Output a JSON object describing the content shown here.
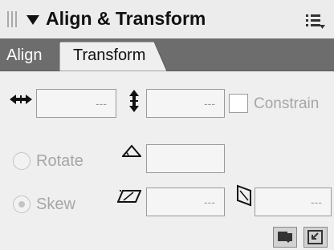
{
  "panel": {
    "title": "Align & Transform",
    "tabs": [
      {
        "label": "Align",
        "active": false
      },
      {
        "label": "Transform",
        "active": true
      }
    ]
  },
  "transform": {
    "width_value": "---",
    "height_value": "---",
    "constrain_label": "Constrain",
    "constrain_checked": false,
    "rotate_label": "Rotate",
    "rotate_value": "",
    "skew_label": "Skew",
    "skew_selected": true,
    "skew_h_value": "---",
    "skew_v_value": "---"
  },
  "icons": {
    "grip": "grip-icon",
    "collapse": "triangle-down-icon",
    "options": "options-menu-icon",
    "width": "width-arrows-icon",
    "height": "height-arrows-icon",
    "rotate": "rotate-angle-icon",
    "skew_h": "skew-horizontal-icon",
    "skew_v": "skew-vertical-icon",
    "apply_copy": "apply-to-copy-icon",
    "apply": "apply-icon"
  },
  "colors": {
    "title_bg": "#ececec",
    "tab_row_bg": "#6d6d6d",
    "panel_bg": "#efefef",
    "disabled_text": "#a6a6a6"
  }
}
